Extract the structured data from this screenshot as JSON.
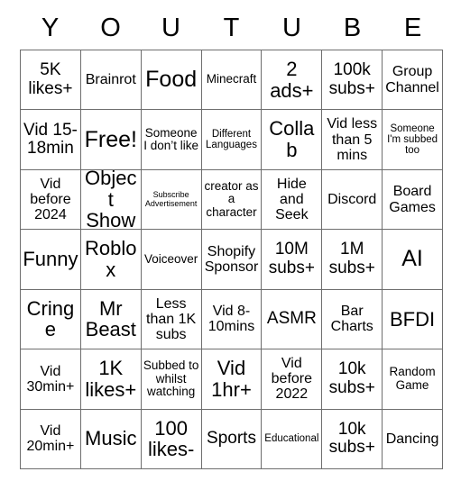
{
  "card": {
    "title_letters": [
      "Y",
      "O",
      "U",
      "T",
      "U",
      "B",
      "E"
    ],
    "columns": 7,
    "rows": 7,
    "grid_line_color": "#6e6e6e",
    "background_color": "#ffffff",
    "text_color": "#000000",
    "cells": [
      [
        {
          "text": "5K likes+",
          "size": "lg"
        },
        {
          "text": "Brainrot",
          "size": "md"
        },
        {
          "text": "Food",
          "size": "xxl"
        },
        {
          "text": "Minecraft",
          "size": "sm"
        },
        {
          "text": "2 ads+",
          "size": "xl"
        },
        {
          "text": "100k subs+",
          "size": "lg"
        },
        {
          "text": "Group Channel",
          "size": "md"
        }
      ],
      [
        {
          "text": "Vid 15-18min",
          "size": "lg"
        },
        {
          "text": "Free!",
          "size": "xxl"
        },
        {
          "text": "Someone I don’t like",
          "size": "sm"
        },
        {
          "text": "Different Languages",
          "size": "xs"
        },
        {
          "text": "Collab",
          "size": "xl"
        },
        {
          "text": "Vid less than 5 mins",
          "size": "md"
        },
        {
          "text": "Someone I'm subbed too",
          "size": "xs"
        }
      ],
      [
        {
          "text": "Vid before 2024",
          "size": "md"
        },
        {
          "text": "Object Show",
          "size": "xl"
        },
        {
          "text": "Subscribe Advertisement",
          "size": "xxs"
        },
        {
          "text": "creator as a character",
          "size": "sm"
        },
        {
          "text": "Hide and Seek",
          "size": "md"
        },
        {
          "text": "Discord",
          "size": "md"
        },
        {
          "text": "Board Games",
          "size": "md"
        }
      ],
      [
        {
          "text": "Funny",
          "size": "xl"
        },
        {
          "text": "Roblox",
          "size": "xl"
        },
        {
          "text": "Voiceover",
          "size": "sm"
        },
        {
          "text": "Shopify Sponsor",
          "size": "md"
        },
        {
          "text": "10M subs+",
          "size": "lg"
        },
        {
          "text": "1M subs+",
          "size": "lg"
        },
        {
          "text": "AI",
          "size": "xxl"
        }
      ],
      [
        {
          "text": "Cringe",
          "size": "xl"
        },
        {
          "text": "Mr Beast",
          "size": "xl"
        },
        {
          "text": "Less than 1K subs",
          "size": "md"
        },
        {
          "text": "Vid 8-10mins",
          "size": "md"
        },
        {
          "text": "ASMR",
          "size": "lg"
        },
        {
          "text": "Bar Charts",
          "size": "md"
        },
        {
          "text": "BFDI",
          "size": "xl"
        }
      ],
      [
        {
          "text": "Vid 30min+",
          "size": "md"
        },
        {
          "text": "1K likes+",
          "size": "xl"
        },
        {
          "text": "Subbed to whilst watching",
          "size": "sm"
        },
        {
          "text": "Vid 1hr+",
          "size": "xl"
        },
        {
          "text": "Vid before 2022",
          "size": "md"
        },
        {
          "text": "10k subs+",
          "size": "lg"
        },
        {
          "text": "Random Game",
          "size": "sm"
        }
      ],
      [
        {
          "text": "Vid 20min+",
          "size": "md"
        },
        {
          "text": "Music",
          "size": "xl"
        },
        {
          "text": "100 likes-",
          "size": "xl"
        },
        {
          "text": "Sports",
          "size": "lg"
        },
        {
          "text": "Educational",
          "size": "xs"
        },
        {
          "text": "10k subs+",
          "size": "lg"
        },
        {
          "text": "Dancing",
          "size": "md"
        }
      ]
    ]
  }
}
